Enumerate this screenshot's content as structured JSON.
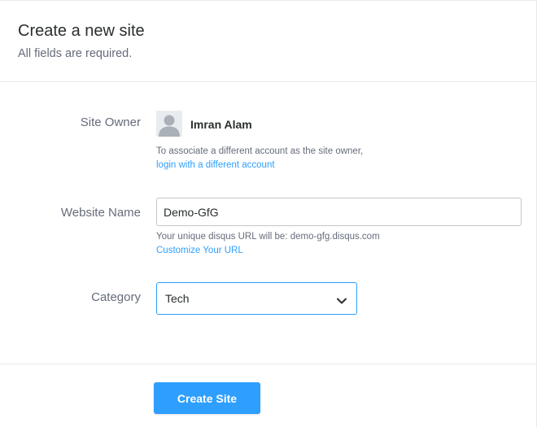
{
  "header": {
    "title": "Create a new site",
    "subtitle": "All fields are required."
  },
  "form": {
    "site_owner": {
      "label": "Site Owner",
      "avatar_icon": "user-avatar-icon",
      "name": "Imran Alam",
      "help": "To associate a different account as the site owner,",
      "link": "login with a different account"
    },
    "website_name": {
      "label": "Website Name",
      "value": "Demo-GfG",
      "help": "Your unique disqus URL will be: demo-gfg.disqus.com",
      "link": "Customize Your URL"
    },
    "category": {
      "label": "Category",
      "selected": "Tech",
      "icon": "chevron-down-icon"
    }
  },
  "actions": {
    "create_label": "Create Site"
  },
  "colors": {
    "accent": "#2e9fff",
    "text": "#2a2e2e",
    "muted": "#656c7a",
    "border": "#c2c6cc",
    "divider": "#e7e9ee"
  }
}
